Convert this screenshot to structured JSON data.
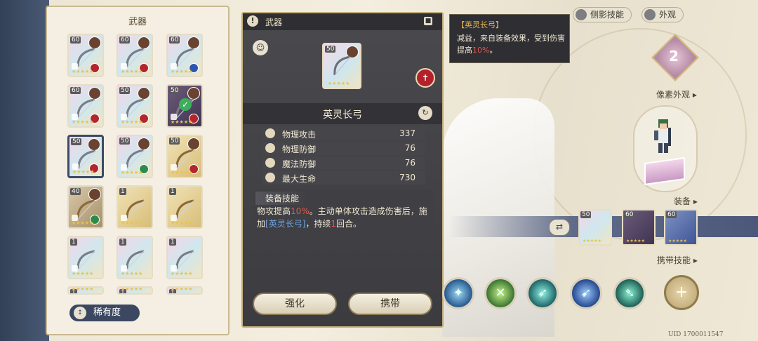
{
  "weapon_panel": {
    "title": "武器",
    "items": [
      {
        "level": "60",
        "rarity": "rainbow",
        "element": "red"
      },
      {
        "level": "60",
        "rarity": "rainbow",
        "element": "red"
      },
      {
        "level": "60",
        "rarity": "rainbow",
        "element": "blue"
      },
      {
        "level": "60",
        "rarity": "rainbow",
        "element": "red"
      },
      {
        "level": "50",
        "rarity": "rainbow",
        "element": "red"
      },
      {
        "level": "50",
        "rarity": "purple",
        "element": "red",
        "equipped": true
      },
      {
        "level": "50",
        "rarity": "rainbow",
        "element": "red",
        "selected": true
      },
      {
        "level": "50",
        "rarity": "rainbow",
        "element": "green"
      },
      {
        "level": "50",
        "rarity": "gold",
        "element": "red"
      },
      {
        "level": "40",
        "rarity": "brown",
        "element": "green"
      },
      {
        "level": "1",
        "rarity": "gold",
        "element": "none"
      },
      {
        "level": "1",
        "rarity": "gold",
        "element": "none"
      },
      {
        "level": "1",
        "rarity": "rainbow",
        "element": "none"
      },
      {
        "level": "1",
        "rarity": "rainbow",
        "element": "none"
      },
      {
        "level": "1",
        "rarity": "rainbow",
        "element": "none"
      },
      {
        "level": "1",
        "rarity": "rainbow",
        "element": "none"
      },
      {
        "level": "1",
        "rarity": "rainbow",
        "element": "none"
      },
      {
        "level": "1",
        "rarity": "rainbow",
        "element": "none"
      }
    ],
    "sort_label": "稀有度",
    "sort_icon": "↕"
  },
  "detail": {
    "category": "武器",
    "warn_icon": "!",
    "lock_icon": "🔒",
    "card_level": "50",
    "card_stars": "★★★★★",
    "weapon_name": "英灵长弓",
    "stats": [
      {
        "label": "物理攻击",
        "value": "337",
        "icon": "sword-icon"
      },
      {
        "label": "物理防御",
        "value": "76",
        "icon": "shield-icon"
      },
      {
        "label": "魔法防御",
        "value": "76",
        "icon": "magic-shield-icon"
      },
      {
        "label": "最大生命",
        "value": "730",
        "icon": "heart-icon"
      }
    ],
    "skill_title": "装备技能",
    "skill_desc": {
      "p1": "物攻提高",
      "p2": "10%",
      "p3": "。主动单体攻击造成伤害后，施加",
      "p4": "[英灵长弓]",
      "p5": "，持续",
      "p6": "1",
      "p7": "回合。"
    },
    "upgrade_label": "强化",
    "carry_label": "携带"
  },
  "tooltip": {
    "title": "【英灵长弓】",
    "desc_a": "减益，来自装备效果，受到伤害提高",
    "desc_b": "10%",
    "desc_c": "。"
  },
  "top_tabs": {
    "shadow_skill": "侧影技能",
    "appearance": "外观"
  },
  "right": {
    "rank": "2",
    "pixel_label": "像素外观",
    "equip_label": "装备",
    "equipped": [
      {
        "level": "50",
        "stars": "★★★★★"
      },
      {
        "level": "60",
        "stars": "★★★★★"
      },
      {
        "level": "60",
        "stars": "★★★★★"
      }
    ],
    "carry_skill_label": "携带技能",
    "uid": "UID 1700011547"
  },
  "colors": {
    "panel_dark": "#3b3b40",
    "gold_border": "#c2ad7c",
    "highlight_red": "#e0574f",
    "highlight_blue": "#6fa3e0",
    "tooltip_title": "#e7b54a"
  }
}
